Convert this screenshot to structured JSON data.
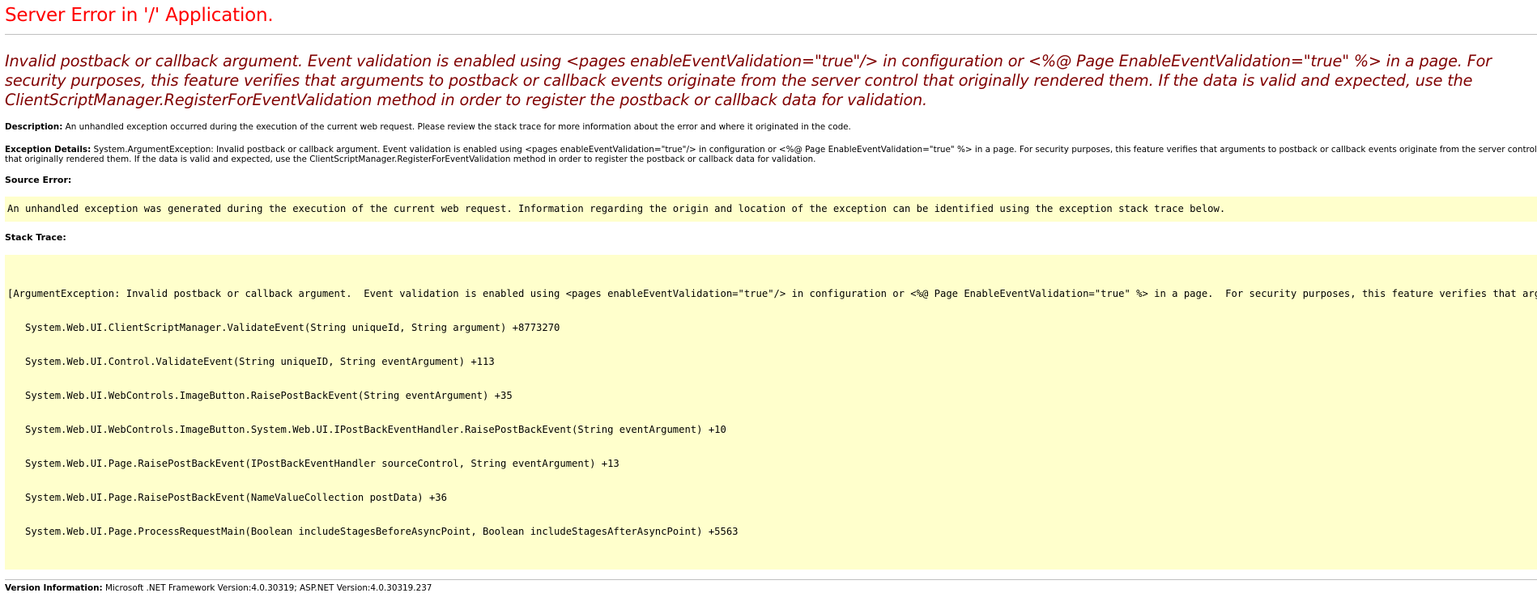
{
  "title": "Server Error in '/' Application.",
  "error_message": "Invalid postback or callback argument.  Event validation is enabled using <pages enableEventValidation=\"true\"/> in configuration or <%@ Page EnableEventValidation=\"true\" %> in a page.  For security purposes, this feature verifies that arguments to postback or callback events originate from the server control that originally rendered them.  If the data is valid and expected, use the ClientScriptManager.RegisterForEventValidation method in order to register the postback or callback data for validation.",
  "description": {
    "label": "Description:",
    "text": " An unhandled exception occurred during the execution of the current web request. Please review the stack trace for more information about the error and where it originated in the code."
  },
  "exception_details": {
    "label": "Exception Details:",
    "text": " System.ArgumentException: Invalid postback or callback argument.  Event validation is enabled using <pages enableEventValidation=\"true\"/> in configuration or <%@ Page EnableEventValidation=\"true\" %> in a page.  For security purposes, this feature verifies that arguments to postback or callback events originate from the server control that originally rendered them.  If the data is valid and expected, use the ClientScriptManager.RegisterForEventValidation method in order to register the postback or callback data for validation."
  },
  "source_error": {
    "label": "Source Error:",
    "text": "An unhandled exception was generated during the execution of the current web request. Information regarding the origin and location of the exception can be identified using the exception stack trace below."
  },
  "stack_trace": {
    "label": "Stack Trace:",
    "lines": [
      "[ArgumentException: Invalid postback or callback argument.  Event validation is enabled using <pages enableEventValidation=\"true\"/> in configuration or <%@ Page EnableEventValidation=\"true\" %> in a page.  For security purposes, this feature verifies that arguments to postback or callback events originate from the server control that originally rendered them.",
      "   System.Web.UI.ClientScriptManager.ValidateEvent(String uniqueId, String argument) +8773270",
      "   System.Web.UI.Control.ValidateEvent(String uniqueID, String eventArgument) +113",
      "   System.Web.UI.WebControls.ImageButton.RaisePostBackEvent(String eventArgument) +35",
      "   System.Web.UI.WebControls.ImageButton.System.Web.UI.IPostBackEventHandler.RaisePostBackEvent(String eventArgument) +10",
      "   System.Web.UI.Page.RaisePostBackEvent(IPostBackEventHandler sourceControl, String eventArgument) +13",
      "   System.Web.UI.Page.RaisePostBackEvent(NameValueCollection postData) +36",
      "   System.Web.UI.Page.ProcessRequestMain(Boolean includeStagesBeforeAsyncPoint, Boolean includeStagesAfterAsyncPoint) +5563"
    ]
  },
  "version_info": {
    "label": "Version Information:",
    "text": " Microsoft .NET Framework Version:4.0.30319; ASP.NET Version:4.0.30319.237"
  },
  "colors": {
    "title": "#ff0000",
    "error_message": "#800000",
    "code_background": "#ffffcc",
    "rule": "#c0c0c0"
  }
}
